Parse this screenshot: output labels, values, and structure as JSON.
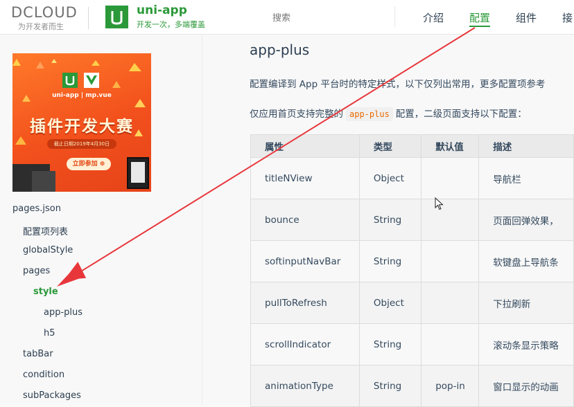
{
  "header": {
    "dcloud_word": "DCLOUD",
    "dcloud_tagline": "为开发者而生",
    "product_badge": "U",
    "product_name": "uni-app",
    "product_tagline": "开发一次，多端覆盖",
    "search_placeholder": "搜索",
    "nav": [
      {
        "label": "介绍",
        "active": false
      },
      {
        "label": "配置",
        "active": true
      },
      {
        "label": "组件",
        "active": false
      },
      {
        "label": "接",
        "active": false
      }
    ]
  },
  "banner": {
    "logo_tag": "uni-app | mp.vue",
    "title": "插件开发大赛",
    "date_line": "截止日期2019年4月30日",
    "button_label": "立即参加 ⊕"
  },
  "sidebar": {
    "items": [
      {
        "label": "pages.json",
        "level": 0,
        "active": false
      },
      {
        "label": "配置项列表",
        "level": 1,
        "active": false
      },
      {
        "label": "globalStyle",
        "level": 1,
        "active": false
      },
      {
        "label": "pages",
        "level": 1,
        "active": false
      },
      {
        "label": "style",
        "level": 2,
        "active": true
      },
      {
        "label": "app-plus",
        "level": 3,
        "active": false
      },
      {
        "label": "h5",
        "level": 3,
        "active": false
      },
      {
        "label": "tabBar",
        "level": 1,
        "active": false
      },
      {
        "label": "condition",
        "level": 1,
        "active": false
      },
      {
        "label": "subPackages",
        "level": 1,
        "active": false
      }
    ]
  },
  "content": {
    "title": "app-plus",
    "para1": "配置编译到 App 平台时的特定样式，以下仅列出常用，更多配置项参考",
    "para2_before": "仅应用首页支持完整的",
    "para2_code": "app-plus",
    "para2_after": "配置，二级页面支持以下配置：",
    "table": {
      "headers": [
        "属性",
        "类型",
        "默认值",
        "描述"
      ],
      "rows": [
        [
          "titleNView",
          "Object",
          "",
          "导航栏"
        ],
        [
          "bounce",
          "String",
          "",
          "页面回弹效果，"
        ],
        [
          "softinputNavBar",
          "String",
          "",
          "软键盘上导航条"
        ],
        [
          "pullToRefresh",
          "Object",
          "",
          "下拉刷新"
        ],
        [
          "scrollIndicator",
          "String",
          "",
          "滚动条显示策略"
        ],
        [
          "animationType",
          "String",
          "pop-in",
          "窗口显示的动画"
        ]
      ]
    }
  },
  "colors": {
    "brand_green": "#2b9939",
    "annotation_red": "#e8373b",
    "banner_orange": "#f2501c"
  },
  "icons": [
    "dcloud-logo",
    "uni-app-logo",
    "mouse-pointer-icon",
    "annotation-arrow"
  ]
}
